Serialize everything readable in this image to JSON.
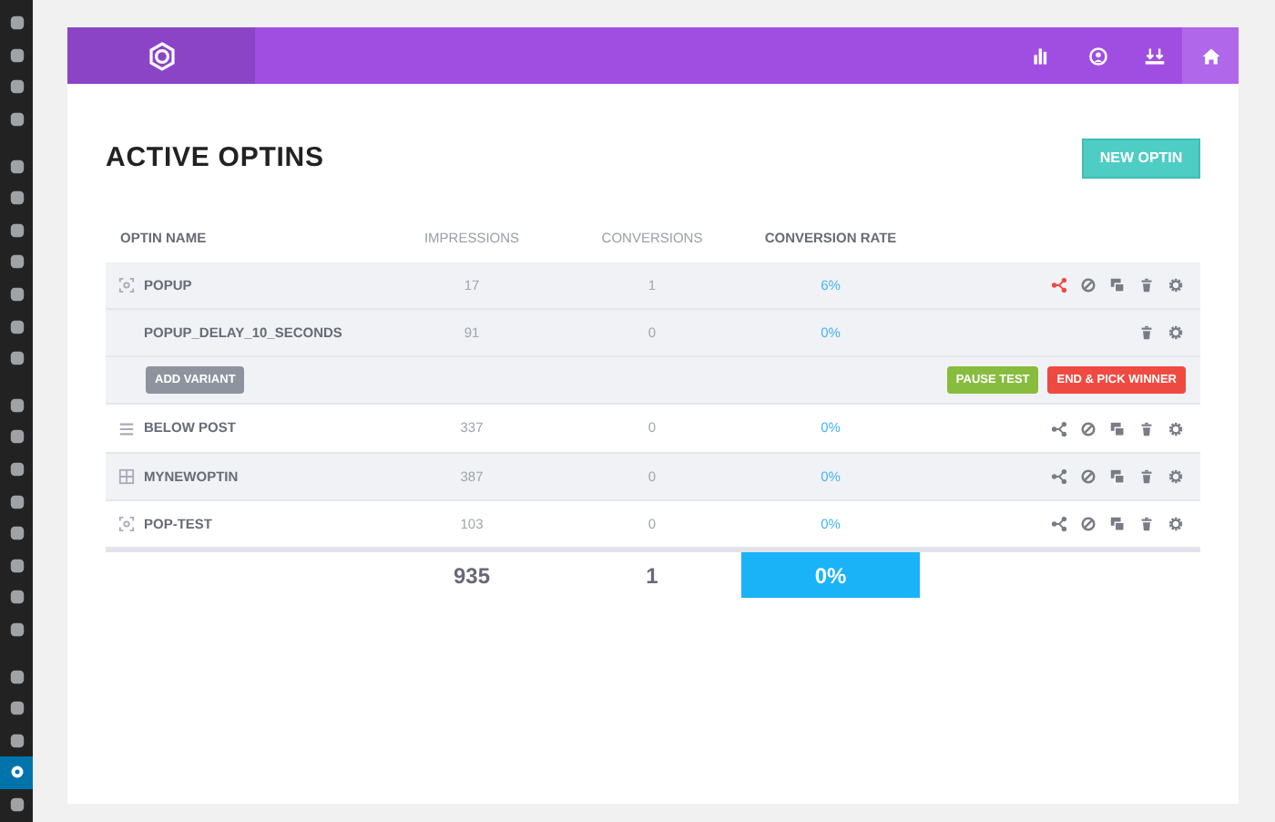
{
  "sidebar": {
    "groups": [
      {
        "items": [
          {
            "selected": false
          },
          {
            "selected": false
          },
          {
            "selected": false
          },
          {
            "selected": false
          }
        ]
      },
      {
        "items": [
          {
            "selected": false
          },
          {
            "selected": false
          },
          {
            "selected": false
          },
          {
            "selected": false
          },
          {
            "selected": false
          },
          {
            "selected": false
          },
          {
            "selected": false
          }
        ]
      },
      {
        "items": [
          {
            "selected": false
          },
          {
            "selected": false
          },
          {
            "selected": false
          },
          {
            "selected": false
          },
          {
            "selected": false
          },
          {
            "selected": false
          },
          {
            "selected": false
          },
          {
            "selected": false
          }
        ]
      },
      {
        "items": [
          {
            "selected": false
          },
          {
            "selected": false
          },
          {
            "selected": false
          },
          {
            "selected": true
          },
          {
            "selected": false
          }
        ]
      }
    ]
  },
  "header": {
    "nav": [
      {
        "kind": "stats",
        "selected": false
      },
      {
        "kind": "account",
        "selected": false
      },
      {
        "kind": "import",
        "selected": false
      },
      {
        "kind": "home",
        "selected": true
      }
    ]
  },
  "title": "ACTIVE OPTINS",
  "new_button": "NEW OPTIN",
  "table": {
    "columns": [
      "OPTIN NAME",
      "IMPRESSIONS",
      "CONVERSIONS",
      "CONVERSION RATE"
    ],
    "rows": [
      {
        "kind": "optin",
        "icon": {
          "kind": "popup"
        },
        "name": "POPUP",
        "impressions": "17",
        "conversions": "1",
        "rate": "6%",
        "shaded": true,
        "actions": [
          {
            "kind": "split",
            "active": true
          },
          {
            "kind": "disable",
            "active": false
          },
          {
            "kind": "duplicate",
            "active": false
          },
          {
            "kind": "delete",
            "active": false
          },
          {
            "kind": "settings",
            "active": false
          }
        ]
      },
      {
        "kind": "variant",
        "name": "POPUP_DELAY_10_SECONDS",
        "impressions": "91",
        "conversions": "0",
        "rate": "0%",
        "shaded": true,
        "actions": [
          {
            "kind": "delete",
            "active": false
          },
          {
            "kind": "settings",
            "active": false
          }
        ]
      },
      {
        "kind": "controls",
        "add": "ADD VARIANT",
        "pause": "PAUSE TEST",
        "end": "END & PICK WINNER",
        "shaded": true
      },
      {
        "kind": "optin",
        "icon": {
          "kind": "below"
        },
        "name": "BELOW POST",
        "impressions": "337",
        "conversions": "0",
        "rate": "0%",
        "shaded": false,
        "actions": [
          {
            "kind": "split",
            "active": false
          },
          {
            "kind": "disable",
            "active": false
          },
          {
            "kind": "duplicate",
            "active": false
          },
          {
            "kind": "delete",
            "active": false
          },
          {
            "kind": "settings",
            "active": false
          }
        ]
      },
      {
        "kind": "optin",
        "icon": {
          "kind": "widget"
        },
        "name": "MYNEWOPTIN",
        "impressions": "387",
        "conversions": "0",
        "rate": "0%",
        "shaded": true,
        "actions": [
          {
            "kind": "split",
            "active": false
          },
          {
            "kind": "disable",
            "active": false
          },
          {
            "kind": "duplicate",
            "active": false
          },
          {
            "kind": "delete",
            "active": false
          },
          {
            "kind": "settings",
            "active": false
          }
        ]
      },
      {
        "kind": "optin",
        "icon": {
          "kind": "popup"
        },
        "name": "POP-TEST",
        "impressions": "103",
        "conversions": "0",
        "rate": "0%",
        "shaded": false,
        "actions": [
          {
            "kind": "split",
            "active": false
          },
          {
            "kind": "disable",
            "active": false
          },
          {
            "kind": "duplicate",
            "active": false
          },
          {
            "kind": "delete",
            "active": false
          },
          {
            "kind": "settings",
            "active": false
          }
        ]
      }
    ],
    "totals": {
      "impressions": "935",
      "conversions": "1",
      "rate": "0%"
    }
  }
}
